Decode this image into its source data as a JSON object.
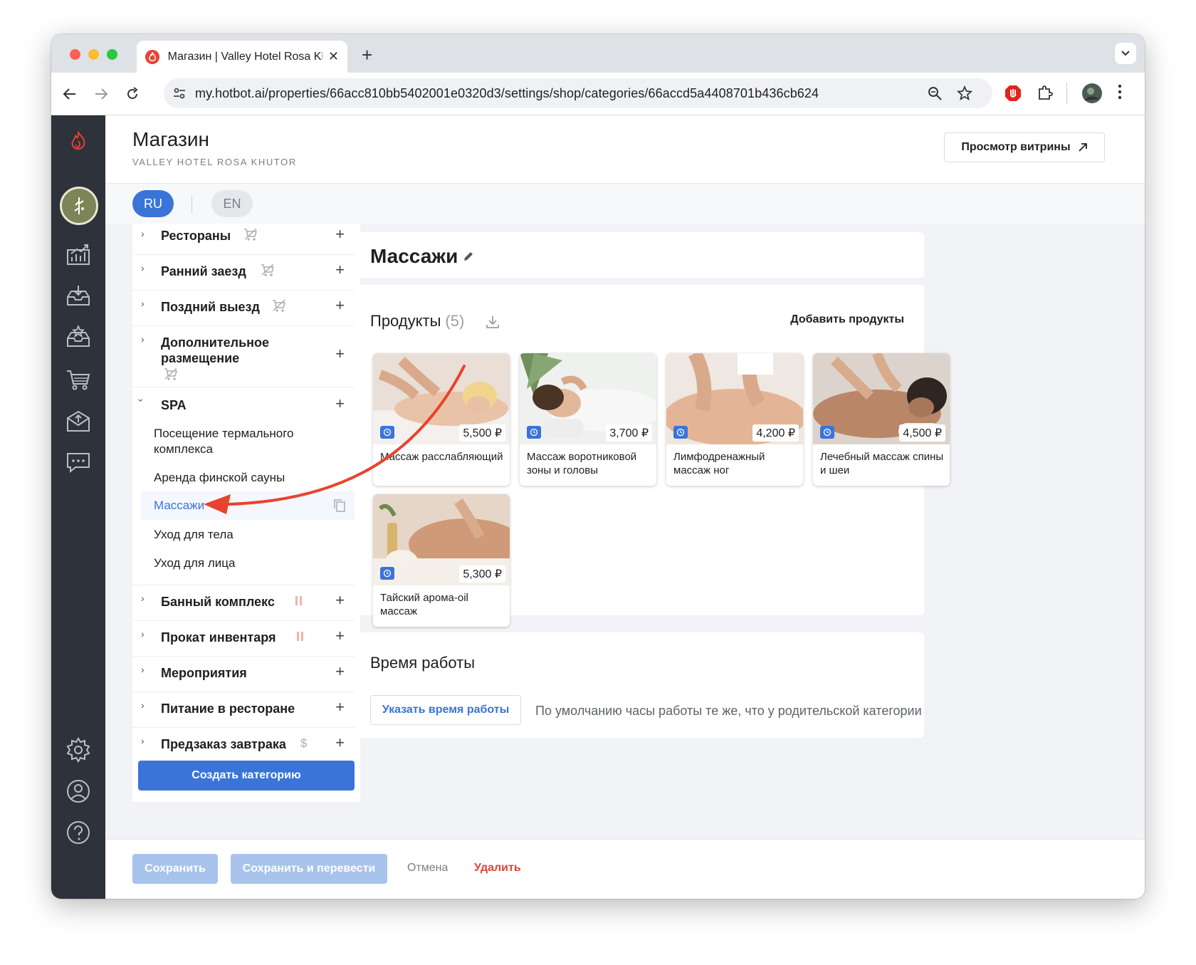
{
  "browser": {
    "tab_title": "Магазин | Valley Hotel Rosa Khutor",
    "url": "my.hotbot.ai/properties/66acc810bb5402001e0320d3/settings/shop/categories/66accd5a4408701b436cb624"
  },
  "header": {
    "title": "Магазин",
    "subtitle": "VALLEY HOTEL ROSA KHUTOR",
    "storefront_button": "Просмотр витрины"
  },
  "languages": {
    "ru": "RU",
    "en": "EN"
  },
  "categories": {
    "restaurants": "Рестораны",
    "early_checkin": "Ранний заезд",
    "late_checkout": "Поздний выезд",
    "extra_line1": "Дополнительное",
    "extra_line2": "размещение",
    "spa": "SPA",
    "spa_items": {
      "thermal_line1": "Посещение термального",
      "thermal_line2": "комплекса",
      "sauna": "Аренда финской сауны",
      "massages": "Массажи",
      "body": "Уход для тела",
      "face": "Уход для лица"
    },
    "bath": "Банный комплекс",
    "rental": "Прокат инвентаря",
    "events": "Мероприятия",
    "dining": "Питание в ресторане",
    "breakfast": "Предзаказ завтрака",
    "create_button": "Создать категорию"
  },
  "category_detail": {
    "title": "Массажи",
    "products_label": "Продукты",
    "products_count": "(5)",
    "add_products": "Добавить продукты",
    "products": [
      {
        "name": "Массаж расслабляющий",
        "price": "5,500 ₽"
      },
      {
        "name": "Массаж воротниковой зоны и головы",
        "price": "3,700 ₽"
      },
      {
        "name": "Лимфодренажный массаж ног",
        "price": "4,200 ₽"
      },
      {
        "name": "Лечебный массаж спины и шеи",
        "price": "4,500 ₽"
      },
      {
        "name": "Тайский арома-oil массаж",
        "price": "5,300 ₽"
      }
    ]
  },
  "working_hours": {
    "title": "Время работы",
    "button": "Указать время работы",
    "note": "По умолчанию часы работы те же, что у родительской категории"
  },
  "footer": {
    "save": "Сохранить",
    "save_translate": "Сохранить и перевести",
    "cancel": "Отмена",
    "delete": "Удалить"
  },
  "colors": {
    "accent": "#3a74d9",
    "danger": "#e0443a",
    "rail": "#2e323a",
    "annotation_arrow": "#e8432d"
  }
}
